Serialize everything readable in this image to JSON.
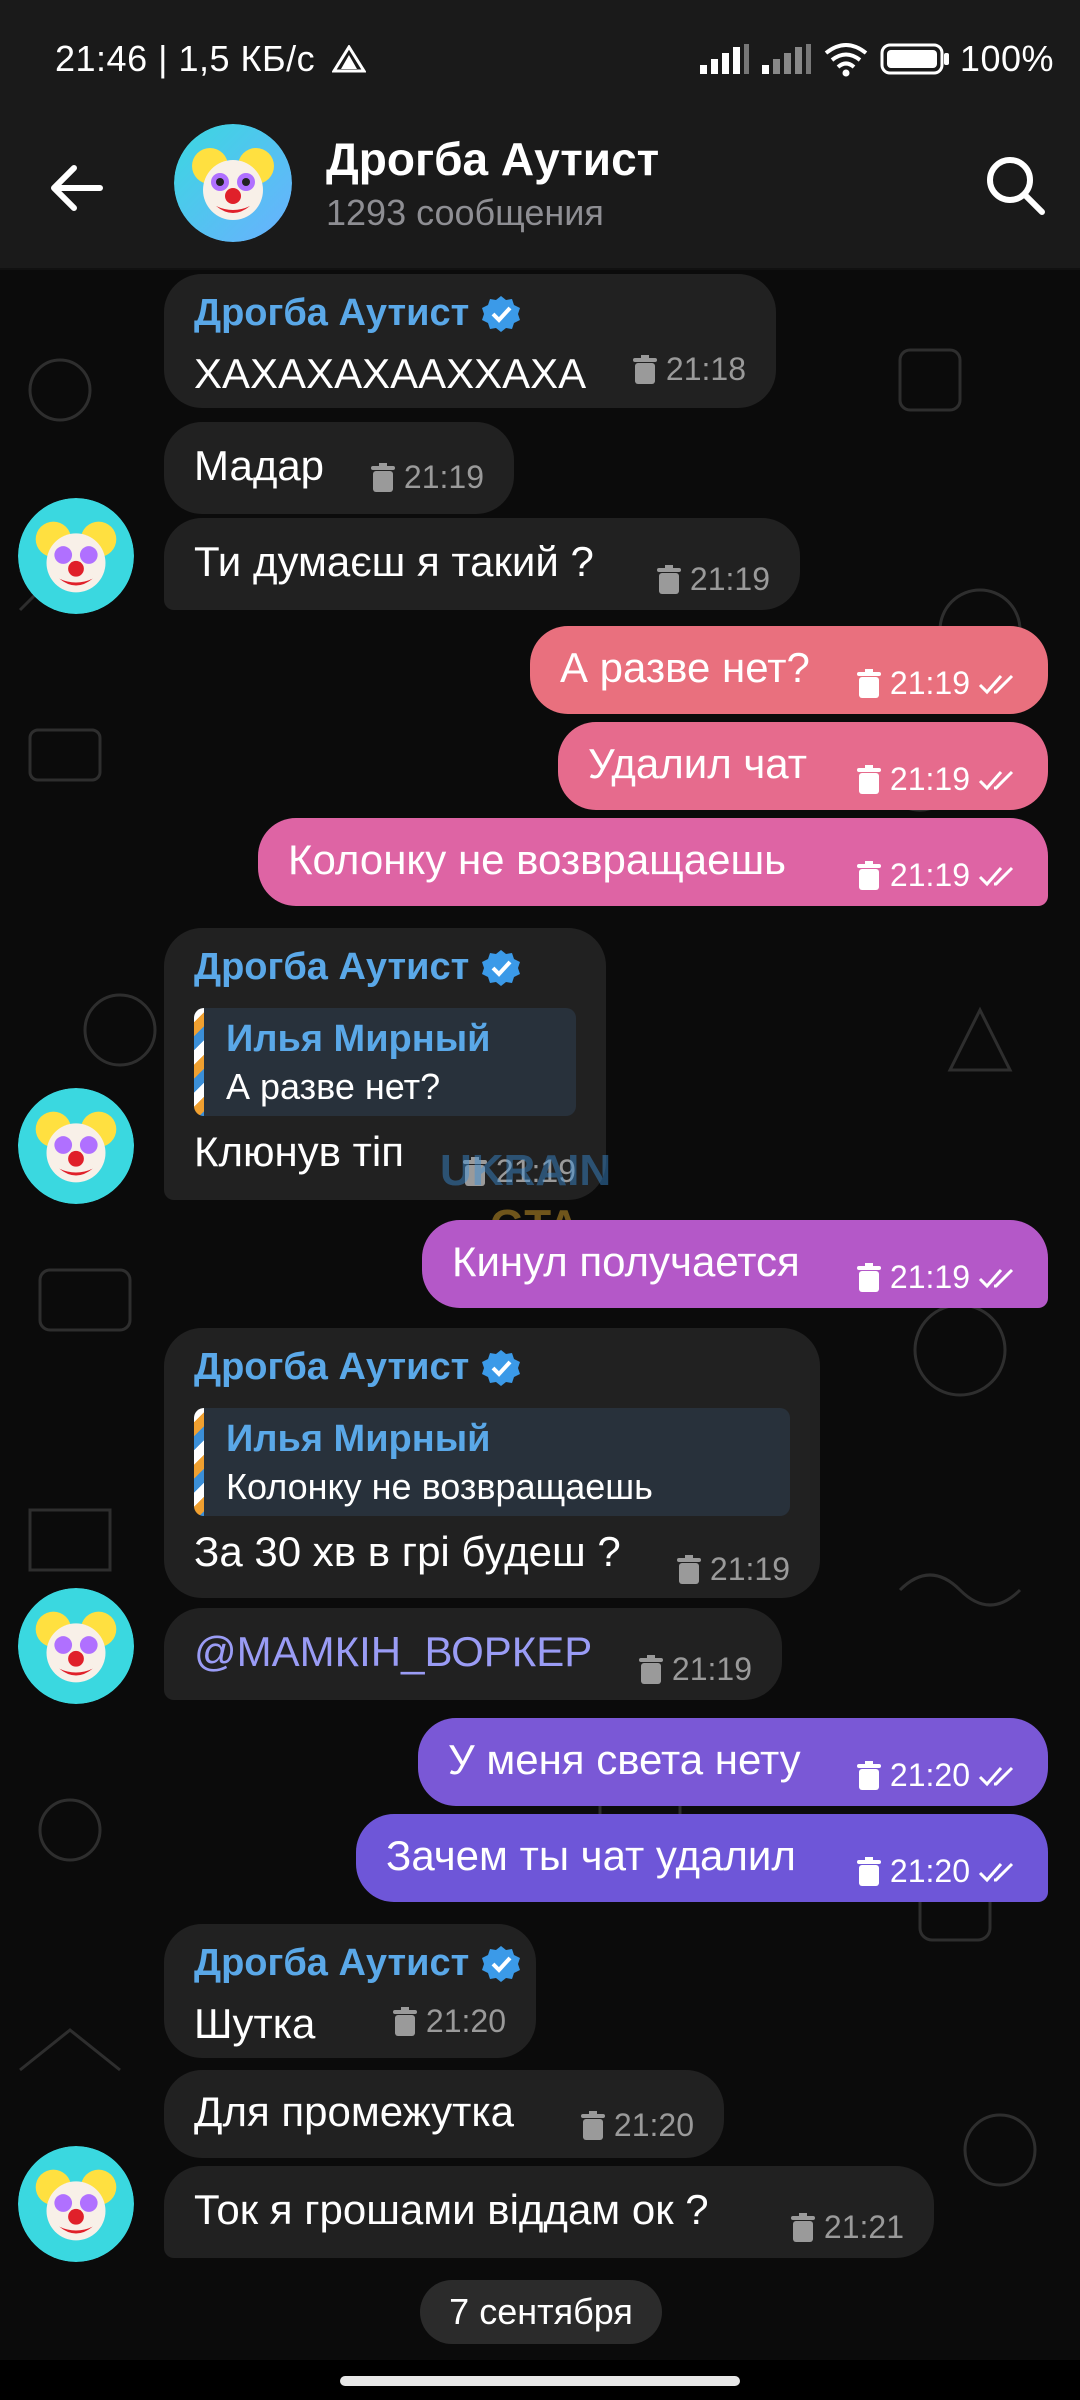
{
  "status_bar": {
    "left_text": "21:46 | 1,5 КБ/с",
    "battery": "100%"
  },
  "header": {
    "title": "Дрогба Аутист",
    "subtitle": "1293 сообщения"
  },
  "colors": {
    "background": "#000000",
    "incoming_bubble": "#212121",
    "sender_name": "#5aa8e8",
    "outgoing_gradient_top": "#e8707a",
    "outgoing_gradient_bottom": "#6a5ad8"
  },
  "messages": [
    {
      "dir": "in",
      "sender": "Дрогба Аутист",
      "text": "ХАХАХАХААХХАХА",
      "time": "21:18"
    },
    {
      "dir": "in",
      "text": "Мадар",
      "time": "21:19"
    },
    {
      "dir": "in",
      "text": "Ти думаєш я такий ?",
      "time": "21:19"
    },
    {
      "dir": "out",
      "text": "А разве нет?",
      "time": "21:19"
    },
    {
      "dir": "out",
      "text": "Удалил чат",
      "time": "21:19"
    },
    {
      "dir": "out",
      "text": "Колонку не возвращаешь",
      "time": "21:19"
    },
    {
      "dir": "in",
      "sender": "Дрогба Аутист",
      "reply_name": "Илья Мирный",
      "reply_text": "А разве нет?",
      "text": "Клюнув тіп",
      "time": "21:19"
    },
    {
      "dir": "out",
      "text": "Кинул получается",
      "time": "21:19"
    },
    {
      "dir": "in",
      "sender": "Дрогба Аутист",
      "reply_name": "Илья Мирный",
      "reply_text": "Колонку не возвращаешь",
      "text": "За 30 хв в грі будеш ?",
      "time": "21:19"
    },
    {
      "dir": "in",
      "text": "@МАМКІН_ВОРКЕР",
      "time": "21:19"
    },
    {
      "dir": "out",
      "text": "У меня света нету",
      "time": "21:20"
    },
    {
      "dir": "out",
      "text": "Зачем ты чат удалил",
      "time": "21:20"
    },
    {
      "dir": "in",
      "sender": "Дрогба Аутист",
      "text": "Шутка",
      "time": "21:20"
    },
    {
      "dir": "in",
      "text": "Для промежутка",
      "time": "21:20"
    },
    {
      "dir": "in",
      "text": "Ток я грошами віддам ок ?",
      "time": "21:21"
    }
  ],
  "date_separator": "7 сентября"
}
